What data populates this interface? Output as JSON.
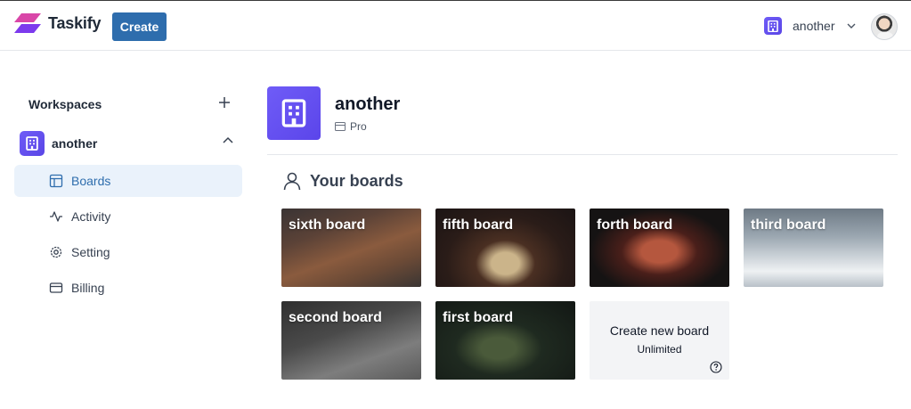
{
  "navbar": {
    "brand": "Taskify",
    "create_label": "Create",
    "org_switcher_name": "another"
  },
  "sidebar": {
    "workspaces_label": "Workspaces",
    "workspace_name": "another",
    "items": [
      {
        "label": "Boards",
        "icon": "layout-icon",
        "active": true
      },
      {
        "label": "Activity",
        "icon": "activity-icon",
        "active": false
      },
      {
        "label": "Setting",
        "icon": "settings-icon",
        "active": false
      },
      {
        "label": "Billing",
        "icon": "credit-card-icon",
        "active": false
      }
    ]
  },
  "main": {
    "org_name": "another",
    "plan": "Pro",
    "boards_heading": "Your boards",
    "boards": [
      {
        "title": "sixth board"
      },
      {
        "title": "fifth board"
      },
      {
        "title": "forth board"
      },
      {
        "title": "third board"
      },
      {
        "title": "second board"
      },
      {
        "title": "first board"
      }
    ],
    "create_board": {
      "title": "Create new board",
      "subtitle": "Unlimited"
    }
  },
  "colors": {
    "primary_button": "#2e6dad",
    "org_accent": "#6f5cf7",
    "active_nav_bg": "#eaf2fb"
  }
}
